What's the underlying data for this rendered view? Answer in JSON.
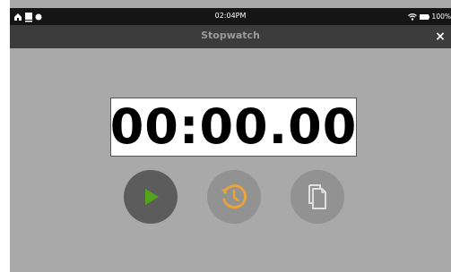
{
  "status_bar": {
    "time": "02:04PM",
    "battery": "100%",
    "icons": [
      "home-icon",
      "notification-icon",
      "dot-icon",
      "wifi-icon",
      "battery-icon"
    ]
  },
  "title_bar": {
    "title": "Stopwatch",
    "close_label": "×"
  },
  "timer": {
    "display": "00:00.00"
  },
  "controls": {
    "icons": [
      "play-icon",
      "reset-icon",
      "copy-icon"
    ],
    "colors": {
      "play": "#55a51c",
      "reset": "#e8a33a",
      "copy": "#e0e0e0"
    }
  }
}
